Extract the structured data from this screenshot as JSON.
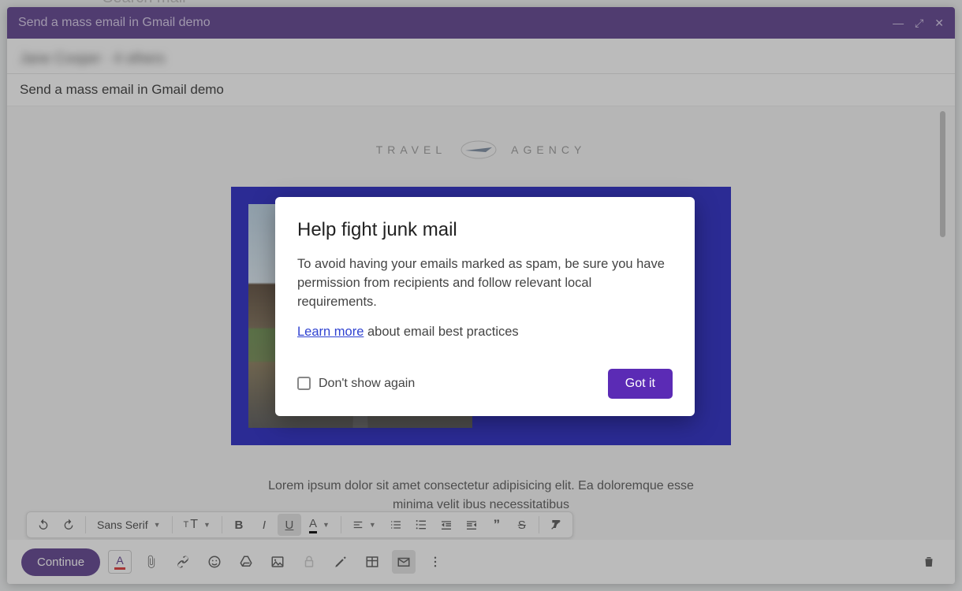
{
  "background": {
    "search_placeholder": "Search mail"
  },
  "window": {
    "title": "Send a mass email in Gmail demo",
    "recipients_blurred": "Jane Cooper · 4 others",
    "subject": "Send a mass email in Gmail demo"
  },
  "email_body": {
    "logo_left": "TRAVEL",
    "logo_right": "AGENCY",
    "lorem": "Lorem ipsum dolor sit amet consectetur adipisicing elit. Ea doloremque esse minima velit ibus necessitatibus"
  },
  "format_toolbar": {
    "undo": "↶",
    "redo": "↷",
    "font_family": "Sans Serif",
    "font_size_icon": "tT",
    "bold": "B",
    "italic": "I",
    "underline": "U",
    "text_color": "A",
    "align": "≡",
    "list_ol": "≣",
    "list_ul": "≡",
    "indent_less": "⇤",
    "indent_more": "⇥",
    "quote": "❞",
    "strike": "S",
    "clear": "T"
  },
  "bottom_bar": {
    "continue": "Continue"
  },
  "modal": {
    "title": "Help fight junk mail",
    "body": "To avoid having your emails marked as spam, be sure you have permission from recipients and follow relevant local requirements.",
    "link_text": "Learn more",
    "link_suffix": " about email best practices",
    "checkbox_label": "Don't show again",
    "confirm": "Got it"
  }
}
